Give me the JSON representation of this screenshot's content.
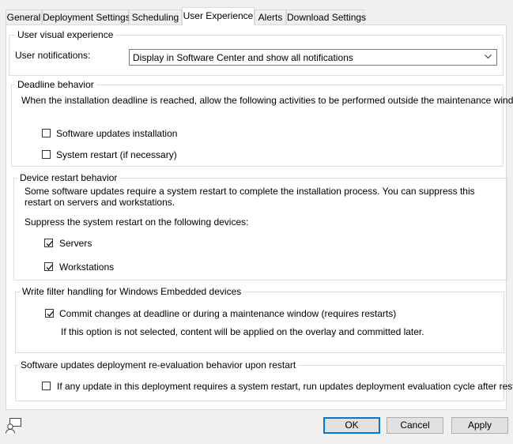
{
  "tabs": [
    {
      "label": "General"
    },
    {
      "label": "Deployment Settings"
    },
    {
      "label": "Scheduling"
    },
    {
      "label": "User Experience",
      "active": true
    },
    {
      "label": "Alerts"
    },
    {
      "label": "Download Settings"
    }
  ],
  "user_visual": {
    "legend": "User visual experience",
    "notifications_label": "User notifications:",
    "notifications_value": "Display in Software Center and show all notifications"
  },
  "deadline": {
    "legend": "Deadline behavior",
    "description": "When the installation deadline is reached, allow the following activities to be performed outside the maintenance window:",
    "software_updates": {
      "label": "Software updates installation",
      "checked": false
    },
    "system_restart": {
      "label": "System restart (if necessary)",
      "checked": false
    }
  },
  "device_restart": {
    "legend": "Device restart behavior",
    "description": "Some software updates require a system restart to complete the installation process. You can suppress this restart on servers and workstations.",
    "suppress_label": "Suppress the system restart on the following devices:",
    "servers": {
      "label": "Servers",
      "checked": true
    },
    "workstations": {
      "label": "Workstations",
      "checked": true
    }
  },
  "write_filter": {
    "legend": "Write filter handling for Windows Embedded devices",
    "commit": {
      "label": "Commit changes at deadline or during a maintenance window (requires restarts)",
      "checked": true
    },
    "note": "If this option is not selected, content will be applied on the overlay and committed later."
  },
  "reevaluation": {
    "legend": "Software updates deployment re-evaluation behavior upon restart",
    "option": {
      "label": "If any update in this deployment requires a system restart, run updates deployment evaluation cycle after restart",
      "checked": false
    }
  },
  "buttons": {
    "ok": "OK",
    "cancel": "Cancel",
    "apply": "Apply"
  },
  "colors": {
    "default_button_border": "#0078d7",
    "panel_background": "#ffffff",
    "window_background": "#f0f0f0"
  }
}
